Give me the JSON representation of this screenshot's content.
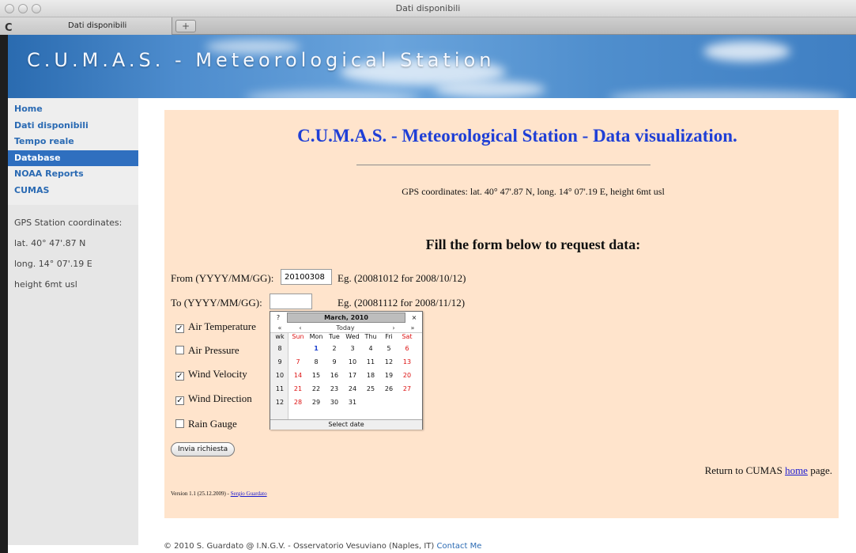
{
  "window": {
    "title": "Dati disponibili"
  },
  "tabs": [
    {
      "label": "Dati disponibili"
    }
  ],
  "new_tab_label": "+",
  "header": {
    "site_title": "C.U.M.A.S. - Meteorological Station"
  },
  "sidebar": {
    "items": [
      {
        "label": "Home"
      },
      {
        "label": "Dati disponibili"
      },
      {
        "label": "Tempo reale"
      },
      {
        "label": "Database",
        "active": true
      },
      {
        "label": "NOAA Reports"
      },
      {
        "label": "CUMAS"
      }
    ],
    "info": [
      "GPS Station coordinates:",
      "lat. 40° 47'.87 N",
      "long. 14° 07'.19 E",
      "height 6mt usl"
    ]
  },
  "main": {
    "title": "C.U.M.A.S. - Meteorological Station - Data visualization.",
    "gps": "GPS coordinates: lat. 40° 47'.87 N, long. 14° 07'.19 E, height 6mt usl",
    "fill_heading": "Fill the form below to request data:",
    "from": {
      "label": "From (YYYY/MM/GG):",
      "value": "20100308",
      "eg": "Eg. (20081012 for 2008/10/12)"
    },
    "to": {
      "label": "To (YYYY/MM/GG):",
      "value": "",
      "eg": "Eg. (20081112 for 2008/11/12)"
    },
    "checkboxes": [
      {
        "label": "Air Temperature",
        "checked": true
      },
      {
        "label": "Air Pressure",
        "checked": false
      },
      {
        "label": "Wind Velocity",
        "checked": true
      },
      {
        "label": "Wind Direction",
        "checked": true
      },
      {
        "label": "Rain Gauge",
        "checked": false
      }
    ],
    "submit_label": "Invia richiesta",
    "return_prefix": "Return to CUMAS ",
    "return_link": "home",
    "return_suffix": " page.",
    "version_text": "Version 1.1 (25.12.2009) - ",
    "version_link": "Sergio Guardato"
  },
  "calendar": {
    "help": "?",
    "title": "March, 2010",
    "close": "×",
    "nav": {
      "prev_year": "«",
      "prev_month": "‹",
      "today": "Today",
      "next_month": "›",
      "next_year": "»"
    },
    "headers": [
      "wk",
      "Sun",
      "Mon",
      "Tue",
      "Wed",
      "Thu",
      "Fri",
      "Sat"
    ],
    "weeks": [
      {
        "wk": "8",
        "days": [
          "",
          "1",
          "2",
          "3",
          "4",
          "5",
          "6"
        ]
      },
      {
        "wk": "9",
        "days": [
          "7",
          "8",
          "9",
          "10",
          "11",
          "12",
          "13"
        ]
      },
      {
        "wk": "10",
        "days": [
          "14",
          "15",
          "16",
          "17",
          "18",
          "19",
          "20"
        ]
      },
      {
        "wk": "11",
        "days": [
          "21",
          "22",
          "23",
          "24",
          "25",
          "26",
          "27"
        ]
      },
      {
        "wk": "12",
        "days": [
          "28",
          "29",
          "30",
          "31",
          "",
          "",
          ""
        ]
      }
    ],
    "highlighted_day": "1",
    "footer": "Select date"
  },
  "footer": {
    "text": "© 2010 S. Guardato @ I.N.G.V. - Osservatorio Vesuviano (Naples, IT) ",
    "link": "Contact Me"
  },
  "colors": {
    "link_blue": "#2a6ab3",
    "title_blue": "#1f3fd6",
    "panel_bg": "#ffe4cc",
    "weekend_red": "#d11111"
  }
}
